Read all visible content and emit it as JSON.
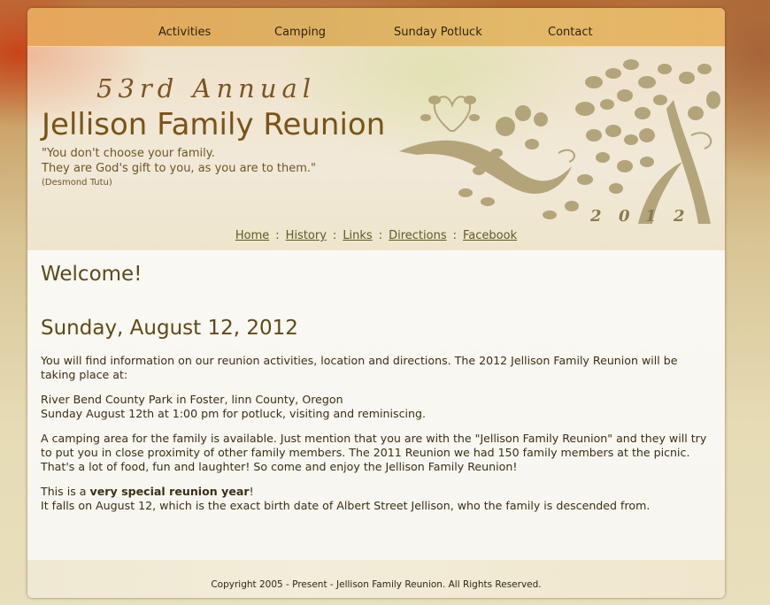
{
  "top_nav": {
    "items": [
      {
        "label": "Activities"
      },
      {
        "label": "Camping"
      },
      {
        "label": "Sunday Potluck"
      },
      {
        "label": "Contact"
      }
    ]
  },
  "banner": {
    "annual": "53rd Annual",
    "title": "Jellison Family Reunion",
    "quote_line1": "\"You don't choose your family.",
    "quote_line2": "They are God's gift to you, as you are to them.\"",
    "quote_author": "(Desmond Tutu)",
    "year_digits": [
      "2",
      "0",
      "1",
      "2"
    ],
    "art_icon": "tree-with-heart-icon"
  },
  "sub_nav": {
    "items": [
      {
        "label": "Home"
      },
      {
        "label": "History"
      },
      {
        "label": "Links"
      },
      {
        "label": "Directions"
      },
      {
        "label": "Facebook"
      }
    ],
    "separator": ":"
  },
  "content": {
    "welcome": "Welcome!",
    "date_heading": "Sunday, August 12, 2012",
    "intro": "You will find information on our reunion activities, location and directions. The 2012 Jellison Family Reunion will be taking place at:",
    "location_line1": "River Bend County Park in Foster, linn County, Oregon",
    "location_line2": "Sunday August 12th at 1:00 pm for potluck, visiting and reminiscing.",
    "camping": "A camping area for the family is available. Just mention that you are with the \"Jellison Family Reunion\" and they will try to put you in close proximity of other family members. The 2011 Reunion we had 150 family members at the picnic. That's a lot of food, fun and laughter! So come and enjoy the Jellison Family Reunion!",
    "special_prefix": "This is a ",
    "special_bold": "very special reunion year",
    "special_suffix": "!",
    "special_line2": "It falls on August 12, which is the exact birth date of Albert Street Jellison, who the family is descended from."
  },
  "footer": {
    "copyright": "Copyright 2005 - Present - Jellison Family Reunion. All Rights Reserved."
  },
  "colors": {
    "title": "#7a5316",
    "heading": "#5d4a17",
    "link": "#5f5a22",
    "art": "#b3a47a",
    "nav_bar": "#dcb062"
  }
}
